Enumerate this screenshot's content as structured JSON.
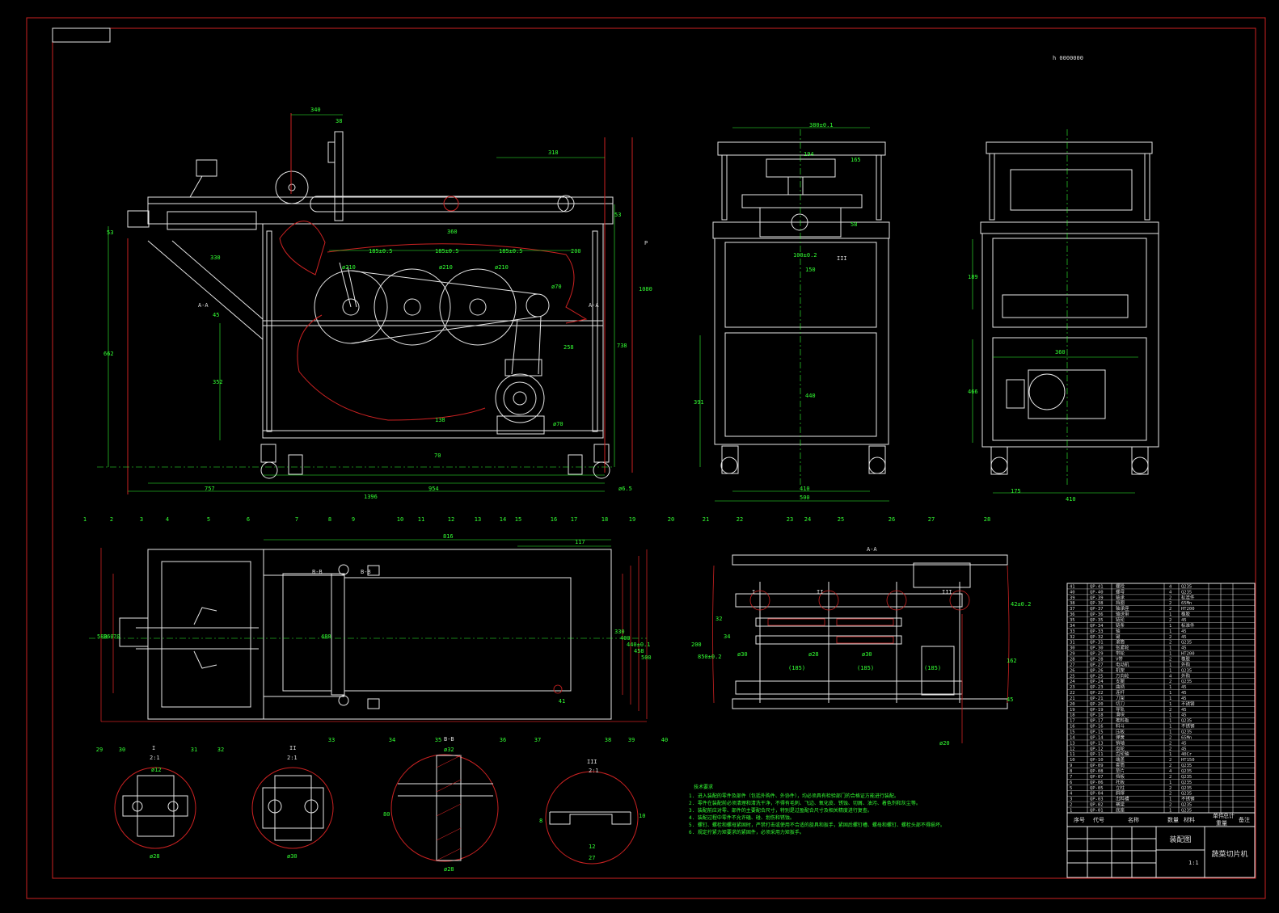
{
  "sheet": {
    "page_background": "#000000",
    "frame_color": "#cc2222",
    "line_color": "#e6e6e6",
    "dimension_color": "#33ff33",
    "corner_mark": "",
    "top_right_note": "h 0000000"
  },
  "views": {
    "section_a": "A-A",
    "section_b": "B-B",
    "detail_i": "I",
    "detail_ii": "II",
    "detail_iii": "III",
    "scale_label": "2:1"
  },
  "dimensions": {
    "front": [
      "340",
      "38",
      "318",
      "53",
      "1080",
      "185±0.5",
      "185±0.5",
      "185±0.5",
      "200",
      "ø210",
      "ø210",
      "ø210",
      "ø70",
      "ø70",
      "330",
      "360",
      "53",
      "258",
      "738",
      "662",
      "45",
      "352",
      "138",
      "70",
      "757",
      "954",
      "1396",
      "ø6.5",
      "P"
    ],
    "side": [
      "380±0.1",
      "194",
      "165",
      "58",
      "100±0.2",
      "150",
      "440",
      "391",
      "410",
      "500",
      "III"
    ],
    "rear": [
      "189",
      "360",
      "466",
      "175",
      "410"
    ],
    "top": [
      "816",
      "117",
      "580",
      "360",
      "70",
      "480",
      "330",
      "400",
      "440±0.1",
      "458",
      "500"
    ],
    "section": [
      "32",
      "34",
      "200",
      "850±0.2",
      "ø30",
      "ø30",
      "(185)",
      "(185)",
      "(185)",
      "ø20",
      "162",
      "42±0.2",
      "45",
      "ø28"
    ],
    "details": [
      "ø12",
      "ø28",
      "ø30",
      "ø32",
      "80",
      "ø28",
      "8",
      "12",
      "27",
      "10"
    ]
  },
  "balloons": [
    "1",
    "2",
    "3",
    "4",
    "5",
    "6",
    "7",
    "8",
    "9",
    "10",
    "11",
    "12",
    "13",
    "14",
    "15",
    "16",
    "17",
    "18",
    "19",
    "20",
    "21",
    "22",
    "23",
    "24",
    "25",
    "26",
    "27",
    "28",
    "29",
    "30",
    "31",
    "32",
    "33",
    "34",
    "35",
    "36",
    "37",
    "38",
    "39",
    "40",
    "41"
  ],
  "tech_requirements": {
    "title": "技术要求",
    "lines": [
      "1. 进入装配的零件及部件（包括外购件、外协件），均必须具有检验部门的合格证方能进行装配。",
      "2. 零件在装配前必须清理和清洗干净，不得有毛刺、飞边、氧化皮、锈蚀、切屑、油污、着色剂和灰尘等。",
      "3. 装配前应对零、部件的主要配合尺寸，特别是过盈配合尺寸及相关精度进行复查。",
      "4. 装配过程中零件不允许磕、碰、划伤和锈蚀。",
      "5. 螺钉、螺栓和螺母紧固时，严禁打击或使用不合适的旋具和扳手，紧固后螺钉槽、螺母和螺钉、螺栓头部不得损坏。",
      "6. 规定拧紧力矩要求的紧固件，必须采用力矩扳手。"
    ]
  },
  "title_block": {
    "assembly": "装配图",
    "machine_name": "蔬菜切片机",
    "scale": "1:1",
    "headers": [
      "序号",
      "代号",
      "名称",
      "数量",
      "材料",
      "单件",
      "总计",
      "备注"
    ],
    "weight_headers": [
      "单件",
      "总计"
    ],
    "weight_label": "重量"
  },
  "bom_rows": [
    {
      "no": "41",
      "code": "QP-41",
      "name": "螺栓",
      "qty": "4",
      "mat": "Q235"
    },
    {
      "no": "40",
      "code": "QP-40",
      "name": "螺母",
      "qty": "4",
      "mat": "Q235"
    },
    {
      "no": "39",
      "code": "QP-39",
      "name": "轴承",
      "qty": "2",
      "mat": "标准件"
    },
    {
      "no": "38",
      "code": "QP-38",
      "name": "挡圈",
      "qty": "2",
      "mat": "65Mn"
    },
    {
      "no": "37",
      "code": "QP-37",
      "name": "轴承座",
      "qty": "2",
      "mat": "HT200"
    },
    {
      "no": "36",
      "code": "QP-36",
      "name": "输送带",
      "qty": "1",
      "mat": "橡胶"
    },
    {
      "no": "35",
      "code": "QP-35",
      "name": "链轮",
      "qty": "2",
      "mat": "45"
    },
    {
      "no": "34",
      "code": "QP-34",
      "name": "链条",
      "qty": "1",
      "mat": "标准件"
    },
    {
      "no": "33",
      "code": "QP-33",
      "name": "轴",
      "qty": "1",
      "mat": "45"
    },
    {
      "no": "32",
      "code": "QP-32",
      "name": "键",
      "qty": "2",
      "mat": "45"
    },
    {
      "no": "31",
      "code": "QP-31",
      "name": "滚筒",
      "qty": "2",
      "mat": "Q235"
    },
    {
      "no": "30",
      "code": "QP-30",
      "name": "张紧轮",
      "qty": "1",
      "mat": "45"
    },
    {
      "no": "29",
      "code": "QP-29",
      "name": "带轮",
      "qty": "1",
      "mat": "HT200"
    },
    {
      "no": "28",
      "code": "QP-28",
      "name": "V带",
      "qty": "2",
      "mat": "橡胶"
    },
    {
      "no": "27",
      "code": "QP-27",
      "name": "电动机",
      "qty": "1",
      "mat": "外购"
    },
    {
      "no": "26",
      "code": "QP-26",
      "name": "机架",
      "qty": "1",
      "mat": "Q235"
    },
    {
      "no": "25",
      "code": "QP-25",
      "name": "万向轮",
      "qty": "4",
      "mat": "外购"
    },
    {
      "no": "24",
      "code": "QP-24",
      "name": "支腿",
      "qty": "2",
      "mat": "Q235"
    },
    {
      "no": "23",
      "code": "QP-23",
      "name": "曲柄",
      "qty": "1",
      "mat": "45"
    },
    {
      "no": "22",
      "code": "QP-22",
      "name": "连杆",
      "qty": "1",
      "mat": "45"
    },
    {
      "no": "21",
      "code": "QP-21",
      "name": "刀架",
      "qty": "1",
      "mat": "45"
    },
    {
      "no": "20",
      "code": "QP-20",
      "name": "切刀",
      "qty": "1",
      "mat": "不锈钢"
    },
    {
      "no": "19",
      "code": "QP-19",
      "name": "导轨",
      "qty": "2",
      "mat": "45"
    },
    {
      "no": "18",
      "code": "QP-18",
      "name": "滑块",
      "qty": "1",
      "mat": "45"
    },
    {
      "no": "17",
      "code": "QP-17",
      "name": "推料板",
      "qty": "1",
      "mat": "Q235"
    },
    {
      "no": "16",
      "code": "QP-16",
      "name": "料斗",
      "qty": "1",
      "mat": "不锈钢"
    },
    {
      "no": "15",
      "code": "QP-15",
      "name": "压板",
      "qty": "1",
      "mat": "Q235"
    },
    {
      "no": "14",
      "code": "QP-14",
      "name": "弹簧",
      "qty": "2",
      "mat": "65Mn"
    },
    {
      "no": "13",
      "code": "QP-13",
      "name": "销轴",
      "qty": "2",
      "mat": "45"
    },
    {
      "no": "12",
      "code": "QP-12",
      "name": "齿轮",
      "qty": "2",
      "mat": "45"
    },
    {
      "no": "11",
      "code": "QP-11",
      "name": "齿轮轴",
      "qty": "1",
      "mat": "40Cr"
    },
    {
      "no": "10",
      "code": "QP-10",
      "name": "端盖",
      "qty": "2",
      "mat": "HT150"
    },
    {
      "no": "9",
      "code": "QP-09",
      "name": "套筒",
      "qty": "2",
      "mat": "Q235"
    },
    {
      "no": "8",
      "code": "QP-08",
      "name": "垫片",
      "qty": "4",
      "mat": "Q235"
    },
    {
      "no": "7",
      "code": "QP-07",
      "name": "挡板",
      "qty": "2",
      "mat": "Q235"
    },
    {
      "no": "6",
      "code": "QP-06",
      "name": "托板",
      "qty": "1",
      "mat": "Q235"
    },
    {
      "no": "5",
      "code": "QP-05",
      "name": "立柱",
      "qty": "2",
      "mat": "Q235"
    },
    {
      "no": "4",
      "code": "QP-04",
      "name": "斜撑",
      "qty": "2",
      "mat": "Q235"
    },
    {
      "no": "3",
      "code": "QP-03",
      "name": "出料槽",
      "qty": "1",
      "mat": "不锈钢"
    },
    {
      "no": "2",
      "code": "QP-02",
      "name": "横梁",
      "qty": "2",
      "mat": "Q235"
    },
    {
      "no": "1",
      "code": "QP-01",
      "name": "底座",
      "qty": "1",
      "mat": "Q235"
    }
  ]
}
